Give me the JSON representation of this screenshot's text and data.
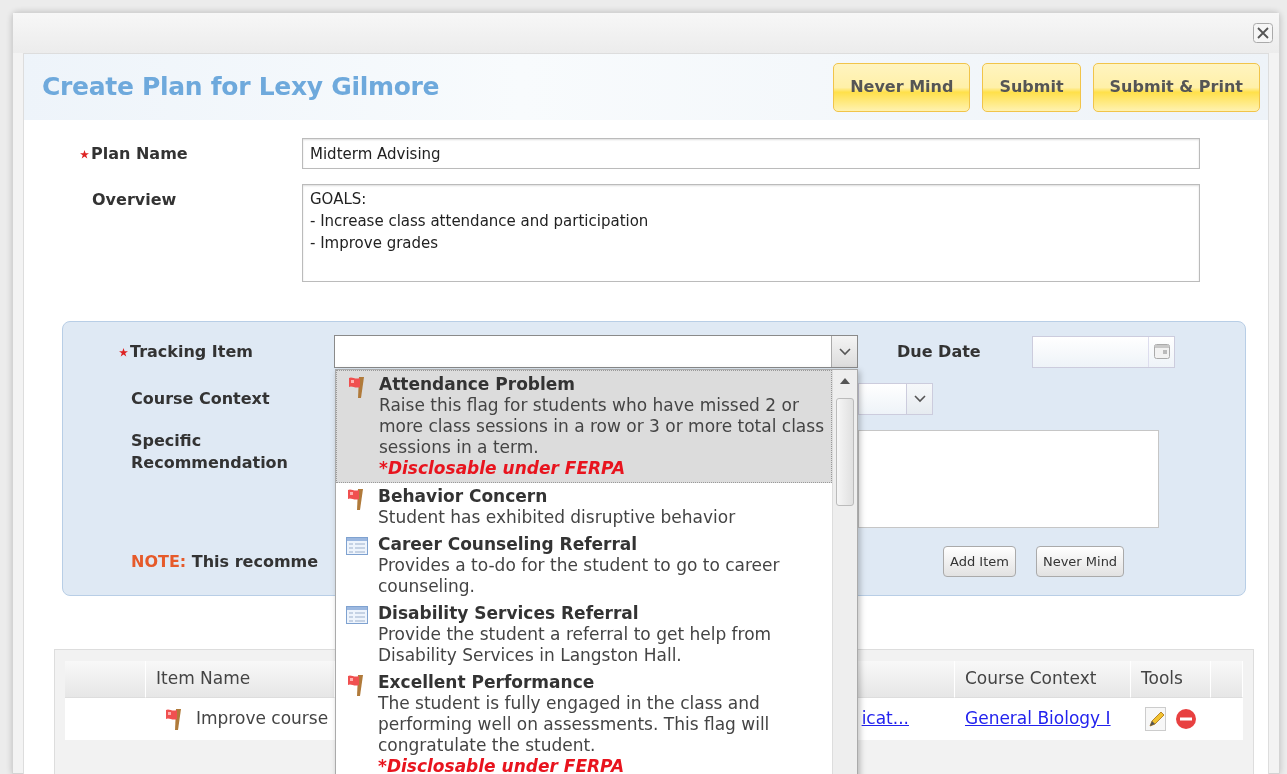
{
  "dialog": {
    "title": "Create Plan for Lexy Gilmore",
    "buttons": [
      "Never Mind",
      "Submit",
      "Submit & Print"
    ]
  },
  "plan_form": {
    "plan_name": {
      "label": "Plan Name",
      "required": true,
      "value": "Midterm Advising"
    },
    "overview": {
      "label": "Overview",
      "required": false,
      "value": "GOALS:\n- Increase class attendance and participation\n- Improve grades"
    }
  },
  "tracking_panel": {
    "tracking_item": {
      "label": "Tracking Item",
      "required": true,
      "expanded": true
    },
    "due_date": {
      "label": "Due Date"
    },
    "course_context": {
      "label": "Course Context"
    },
    "specific_recommendation": {
      "label": "Specific Recommendation"
    },
    "note": {
      "prefix": "NOTE:",
      "text": "This recomme"
    },
    "buttons": [
      "Add Item",
      "Never Mind"
    ]
  },
  "dropdown_items": [
    {
      "kind": "flag",
      "title": "Attendance Problem",
      "description": "Raise this flag for students who have missed 2 or more class sessions in a row or 3 or more total class sessions in a term.",
      "note": "*Disclosable under FERPA",
      "selected": true
    },
    {
      "kind": "flag",
      "title": "Behavior Concern",
      "description": "Student has exhibited disruptive behavior",
      "selected": false
    },
    {
      "kind": "referral",
      "title": "Career Counseling Referral",
      "description": "Provides a to-do for the student to go to career counseling.",
      "selected": false
    },
    {
      "kind": "referral",
      "title": "Disability Services Referral",
      "description": "Provide the student a referral to get help from Disability Services in Langston Hall.",
      "selected": false
    },
    {
      "kind": "flag",
      "title": "Excellent Performance",
      "description": "The student is fully engaged in the class and performing well on assessments. This flag will congratulate the student.",
      "note": "*Disclosable under FERPA",
      "selected": false
    }
  ],
  "plan_items": {
    "columns": [
      "Item Name",
      "Course Context",
      "Tools"
    ],
    "rows": [
      {
        "kind": "flag",
        "item_name": "Improve course",
        "column_3": "icat...",
        "course_context": "General Biology I"
      }
    ]
  }
}
